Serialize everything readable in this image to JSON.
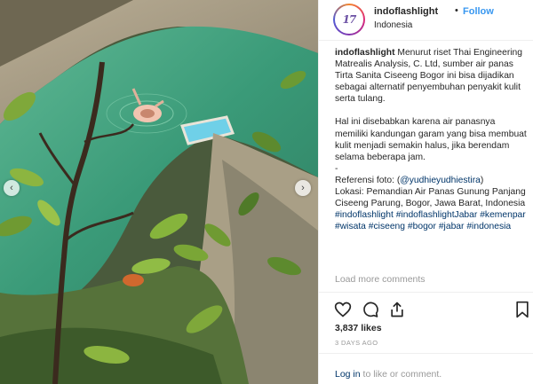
{
  "post": {
    "username": "indoflashlight",
    "separator": "•",
    "follow_label": "Follow",
    "location": "Indonesia",
    "avatar_text": "17",
    "caption_user": "indoflashlight",
    "caption_p1": "Menurut riset Thai Engineering Matrealis Analysis, C. Ltd, sumber air panas Tirta Sanita Ciseeng Bogor ini bisa dijadikan sebagai alternatif penyembuhan penyakit kulit serta tulang.",
    "caption_p2": "Hal ini disebabkan karena air panasnya memiliki kandungan garam yang bisa membuat kulit menjadi semakin halus, jika berendam selama beberapa jam.",
    "caption_dash": "-",
    "ref_prefix": "Referensi foto: (",
    "ref_handle": "@yudhieyudhiestira",
    "ref_suffix": ")",
    "lokasi": "Lokasi: Pemandian Air Panas Gunung Panjang Ciseeng Parung, Bogor, Jawa Barat, Indonesia",
    "hashtags": [
      "#indoflashlight",
      "#indoflashlightJabar",
      "#kemenpar",
      "#wisata",
      "#ciseeng",
      "#bogor",
      "#jabar",
      "#indonesia"
    ],
    "load_more": "Load more comments",
    "likes": "3,837 likes",
    "timestamp": "3 DAYS AGO",
    "login_link": "Log in",
    "login_text": " to like or comment."
  },
  "icons": {
    "prev": "chevron-left-icon",
    "next": "chevron-right-icon",
    "like": "heart-icon",
    "comment": "comment-icon",
    "share": "share-icon",
    "save": "bookmark-icon"
  },
  "colors": {
    "link": "#003569",
    "follow": "#3897f0",
    "muted": "#999999",
    "text": "#262626",
    "water": "#3a9a78"
  }
}
